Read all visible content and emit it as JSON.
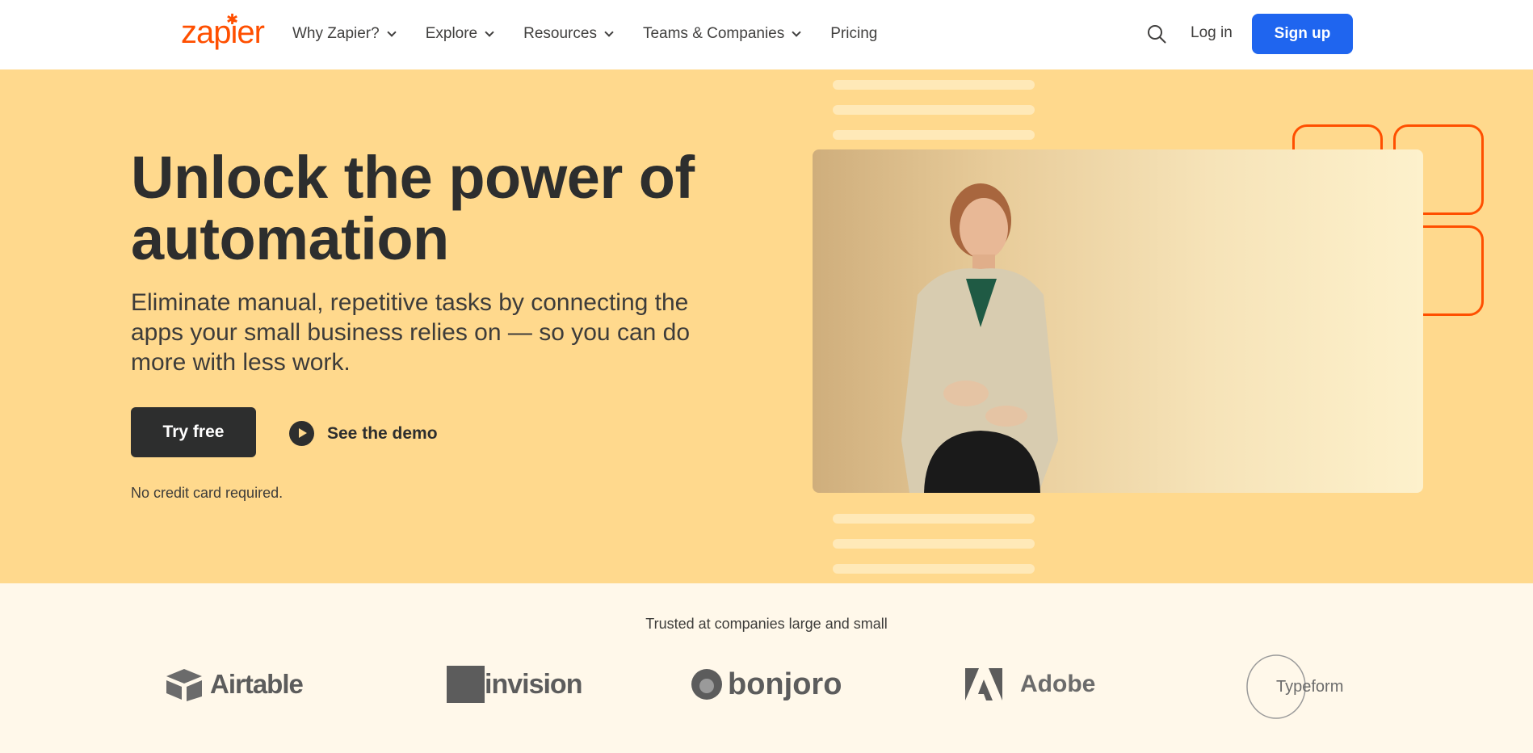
{
  "nav": {
    "logo": "zapier",
    "items": [
      {
        "label": "Why Zapier?",
        "dropdown": true
      },
      {
        "label": "Explore",
        "dropdown": true
      },
      {
        "label": "Resources",
        "dropdown": true
      },
      {
        "label": "Teams & Companies",
        "dropdown": true
      },
      {
        "label": "Pricing",
        "dropdown": false
      }
    ],
    "login_label": "Log in",
    "signup_label": "Sign up"
  },
  "hero": {
    "headline": "Unlock the power of automation",
    "subheadline": "Eliminate manual, repetitive tasks by connecting the apps your small business relies on — so you can do more with less work.",
    "try_label": "Try free",
    "demo_label": "See the demo",
    "note": "No credit card required."
  },
  "trust": {
    "title": "Trusted at companies large and small",
    "logos": [
      "Airtable",
      "invision",
      "bonjoro",
      "Adobe",
      "Typeform"
    ]
  },
  "colors": {
    "accent": "#ff4f00",
    "primary_button": "#1f65ef",
    "hero_bg": "#ffd98d",
    "trust_bg": "#fff8ea",
    "dark": "#2d2e2e"
  },
  "icons": {
    "search": "search-icon",
    "play": "play-icon",
    "chevron": "chevron-down-icon"
  }
}
